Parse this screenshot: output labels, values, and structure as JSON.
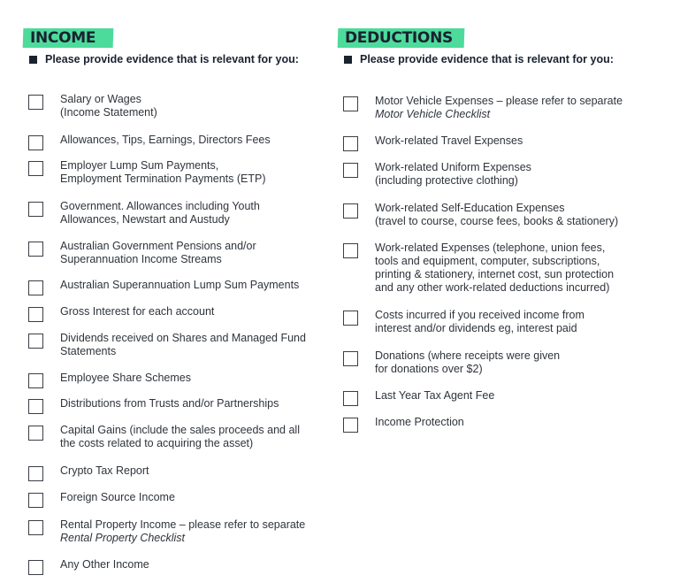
{
  "colors": {
    "heading_bg": "#4ddb9b",
    "ink": "#1a2230",
    "text": "#2f343b"
  },
  "income": {
    "heading": "INCOME",
    "instruction": "Please provide evidence that is relevant for you:",
    "items": [
      {
        "lines": [
          "Salary or Wages",
          "(Income Statement)"
        ],
        "italic": "",
        "checked": false
      },
      {
        "lines": [
          "Allowances, Tips, Earnings, Directors Fees"
        ],
        "italic": "",
        "checked": false
      },
      {
        "lines": [
          "Employer Lump Sum Payments,",
          "Employment Termination Payments (ETP)"
        ],
        "italic": "",
        "checked": false
      },
      {
        "lines": [
          "Government. Allowances including Youth",
          "Allowances, Newstart and Austudy"
        ],
        "italic": "",
        "checked": false
      },
      {
        "lines": [
          "Australian Government Pensions and/or",
          "Superannuation Income Streams"
        ],
        "italic": "",
        "checked": false
      },
      {
        "lines": [
          "Australian Superannuation Lump Sum Payments"
        ],
        "italic": "",
        "checked": false
      },
      {
        "lines": [
          "Gross Interest for each account"
        ],
        "italic": "",
        "checked": false
      },
      {
        "lines": [
          "Dividends received on Shares and Managed Fund",
          "Statements"
        ],
        "italic": "",
        "checked": false
      },
      {
        "lines": [
          "Employee Share Schemes"
        ],
        "italic": "",
        "checked": false
      },
      {
        "lines": [
          "Distributions from Trusts and/or Partnerships"
        ],
        "italic": "",
        "checked": false
      },
      {
        "lines": [
          "Capital Gains (include the sales proceeds and all",
          "the costs related to acquiring the asset)"
        ],
        "italic": "",
        "checked": false
      },
      {
        "lines": [
          "Crypto Tax Report"
        ],
        "italic": "",
        "checked": false
      },
      {
        "lines": [
          "Foreign Source Income"
        ],
        "italic": "",
        "checked": false
      },
      {
        "lines": [
          "Rental Property Income – please refer to separate"
        ],
        "italic": "Rental Property Checklist",
        "checked": false
      },
      {
        "lines": [
          "Any Other Income"
        ],
        "italic": "",
        "checked": false
      }
    ]
  },
  "deductions": {
    "heading": "DEDUCTIONS",
    "instruction": "Please provide evidence that is relevant for you:",
    "items": [
      {
        "lines": [
          "Motor Vehicle Expenses – please refer to separate"
        ],
        "italic": "Motor Vehicle Checklist",
        "checked": false
      },
      {
        "lines": [
          "Work-related Travel Expenses"
        ],
        "italic": "",
        "checked": false
      },
      {
        "lines": [
          "Work-related Uniform Expenses",
          "(including protective clothing)"
        ],
        "italic": "",
        "checked": false
      },
      {
        "lines": [
          "Work-related Self-Education Expenses",
          "(travel to course, course fees, books & stationery)"
        ],
        "italic": "",
        "checked": false
      },
      {
        "lines": [
          "Work-related Expenses (telephone, union fees,",
          "tools and equipment, computer, subscriptions,",
          "printing & stationery, internet cost, sun protection",
          "and any other work-related deductions incurred)"
        ],
        "italic": "",
        "checked": false
      },
      {
        "lines": [
          "Costs incurred if you received income from",
          "interest and/or dividends eg, interest paid"
        ],
        "italic": "",
        "checked": false
      },
      {
        "lines": [
          "Donations (where receipts were given",
          "for donations over $2)"
        ],
        "italic": "",
        "checked": false
      },
      {
        "lines": [
          "Last Year Tax Agent Fee"
        ],
        "italic": "",
        "checked": false
      },
      {
        "lines": [
          "Income Protection"
        ],
        "italic": "",
        "checked": false
      }
    ]
  }
}
